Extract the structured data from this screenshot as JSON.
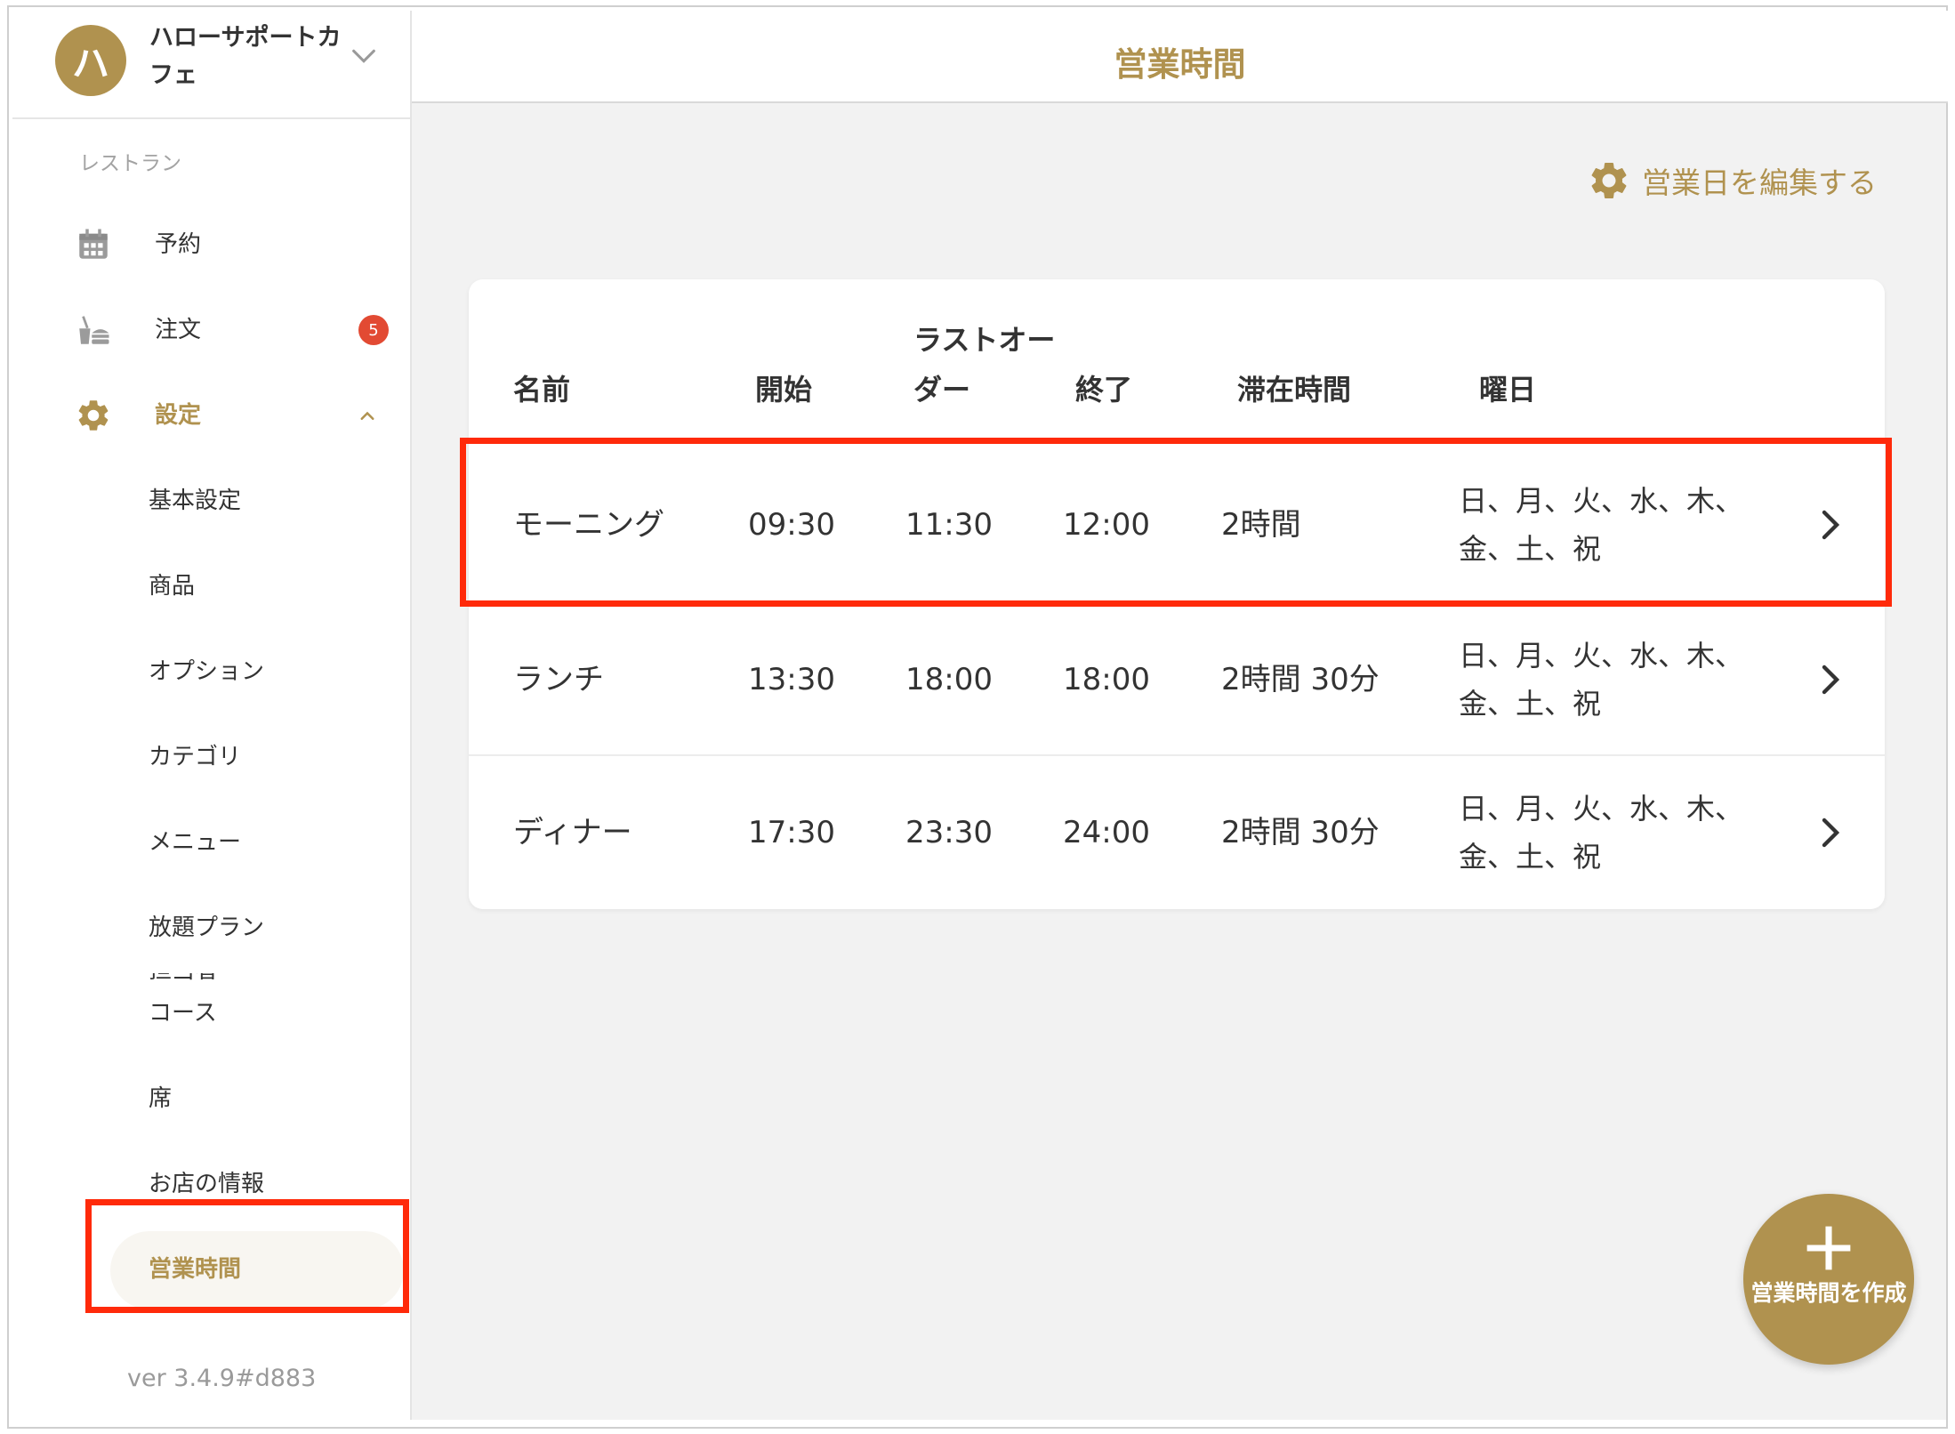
{
  "sidebar": {
    "avatar_letter": "ハ",
    "shop_name": "ハローサポートカフェ",
    "section_label": "レストラン",
    "nav": {
      "reservation": "予約",
      "orders": "注文",
      "orders_badge": "5",
      "settings": "設定"
    },
    "settings_items": [
      "基本設定",
      "商品",
      "オプション",
      "カテゴリ",
      "メニュー",
      "放題プラン",
      "コース",
      "席",
      "お店の情報",
      "営業時間",
      "担当者"
    ],
    "version": "ver 3.4.9#d883"
  },
  "header": {
    "title": "営業時間"
  },
  "toolbar": {
    "edit_days_label": "営業日を編集する"
  },
  "table": {
    "headers": {
      "name": "名前",
      "start": "開始",
      "last_order": "ラストオーダー",
      "end": "終了",
      "stay": "滞在時間",
      "days": "曜日"
    },
    "rows": [
      {
        "name": "モーニング",
        "start": "09:30",
        "last_order": "11:30",
        "end": "12:00",
        "stay": "2時間",
        "days": "日、月、火、水、木、金、土、祝"
      },
      {
        "name": "ランチ",
        "start": "13:30",
        "last_order": "18:00",
        "end": "18:00",
        "stay": "2時間 30分",
        "days": "日、月、火、水、木、金、土、祝"
      },
      {
        "name": "ディナー",
        "start": "17:30",
        "last_order": "23:30",
        "end": "24:00",
        "stay": "2時間 30分",
        "days": "日、月、火、水、木、金、土、祝"
      }
    ]
  },
  "fab": {
    "label": "営業時間を作成"
  },
  "icons": {
    "shop_switch": "chevron-down-icon",
    "reservation": "calendar-icon",
    "orders": "food-tray-icon",
    "settings": "gear-icon",
    "settings_toggle": "chevron-up-icon",
    "edit_days": "gear-icon",
    "row_open": "chevron-right-icon",
    "fab": "plus-icon"
  },
  "colors": {
    "accent": "#b0924f",
    "badge": "#e24a33",
    "highlight_box": "#ff2a0a",
    "main_background": "#f2f2f2"
  }
}
